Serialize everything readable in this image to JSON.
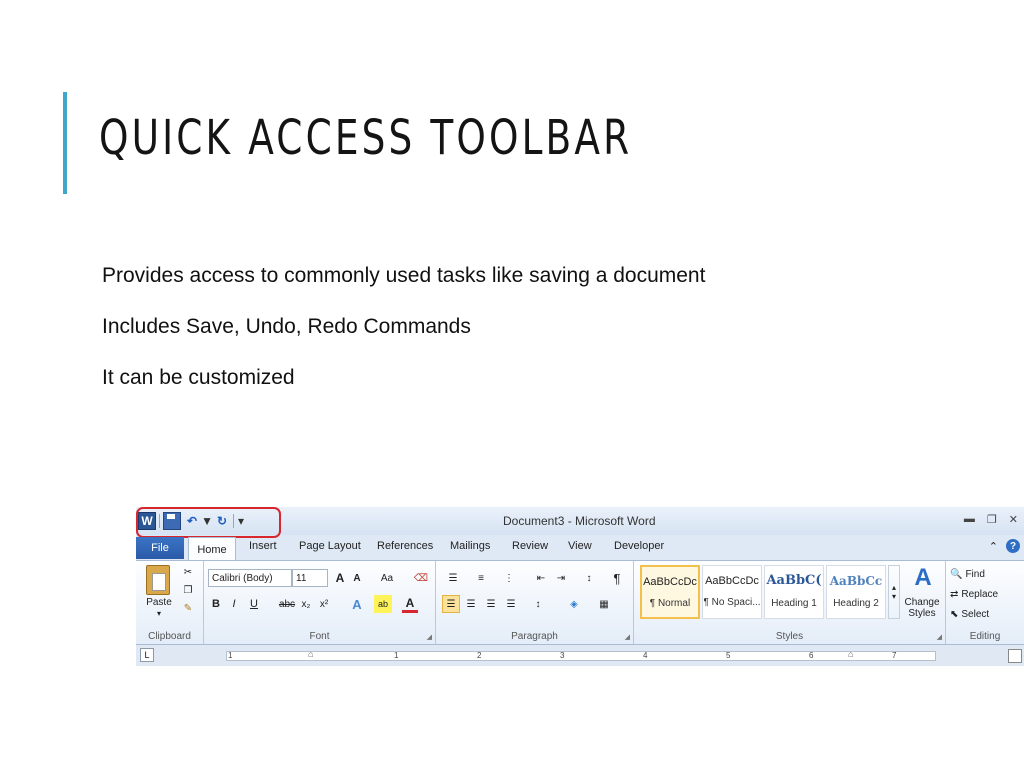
{
  "slide": {
    "title": "QUICK ACCESS TOOLBAR",
    "bullets": [
      "Provides access to commonly used tasks like saving a document",
      "Includes Save, Undo, Redo Commands",
      "It can be customized"
    ],
    "accent_color": "#3fa7c9"
  },
  "word": {
    "window_title": "Document3 - Microsoft Word",
    "qat_highlight_color": "#d8262e",
    "qat_icons": [
      "word-logo-icon",
      "save-icon",
      "undo-icon",
      "redo-icon",
      "customize-dropdown-icon"
    ],
    "tabs": [
      "File",
      "Home",
      "Insert",
      "Page Layout",
      "References",
      "Mailings",
      "Review",
      "View",
      "Developer"
    ],
    "clipboard": {
      "paste": "Paste",
      "label": "Clipboard"
    },
    "font": {
      "name": "Calibri (Body)",
      "size": "11",
      "label": "Font"
    },
    "paragraph": {
      "label": "Paragraph"
    },
    "styles": {
      "label": "Styles",
      "items": [
        {
          "sample": "AaBbCcDc",
          "name": "¶ Normal"
        },
        {
          "sample": "AaBbCcDc",
          "name": "¶ No Spaci..."
        },
        {
          "sample": "AaBbC(",
          "name": "Heading 1"
        },
        {
          "sample": "AaBbCc",
          "name": "Heading 2"
        }
      ],
      "change_styles": "Change Styles"
    },
    "editing": {
      "label": "Editing",
      "find": "Find",
      "replace": "Replace",
      "select": "Select"
    },
    "ruler_numbers": [
      "1",
      "1",
      "2",
      "3",
      "4",
      "5",
      "6",
      "7"
    ]
  }
}
